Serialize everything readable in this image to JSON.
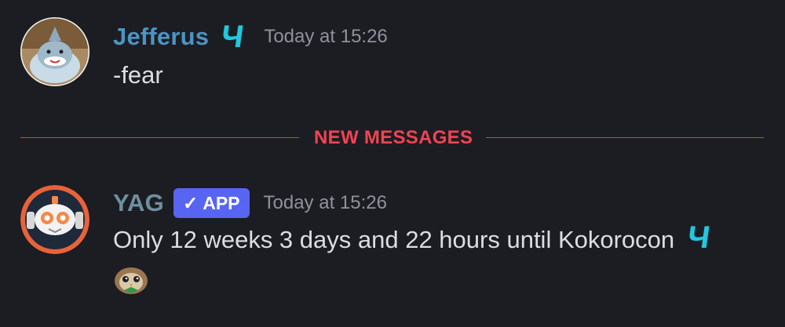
{
  "messages": [
    {
      "author": "Jefferus",
      "author_color": "#4b94c4",
      "role_icon": "Ч",
      "timestamp": "Today at 15:26",
      "content": "-fear"
    },
    {
      "author": "YAG",
      "author_color": "#6f8fa0",
      "app_tag": "APP",
      "app_check": "✓",
      "timestamp": "Today at 15:26",
      "content": "Only 12 weeks 3 days and 22 hours until Kokorocon",
      "role_icon": "Ч"
    }
  ],
  "divider": {
    "label": "NEW MESSAGES",
    "color": "#f04452"
  },
  "colors": {
    "background": "#1c1d22",
    "app_badge": "#5865f2",
    "role_icon": "#26c6e0"
  },
  "icons": {
    "jefferus_avatar": "shark-avatar-icon",
    "yag_avatar": "robot-avatar-icon",
    "reaction_emoji": "owl-emoji-icon"
  }
}
